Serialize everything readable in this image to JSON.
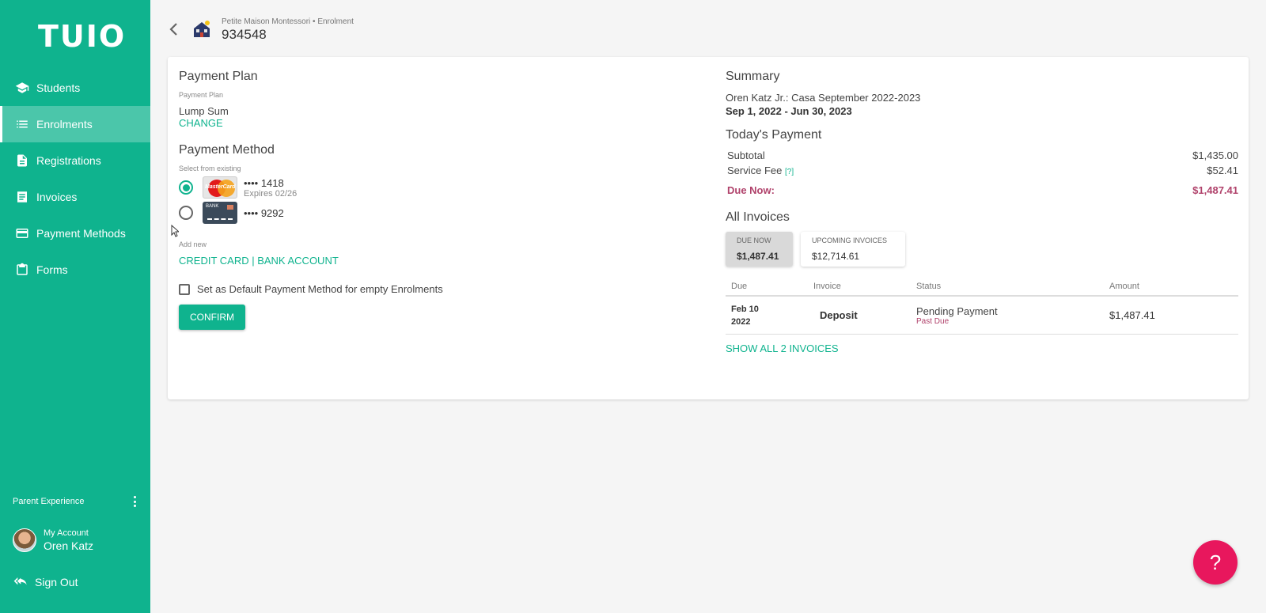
{
  "app": {
    "logo": "TUIO"
  },
  "sidebar": {
    "items": [
      {
        "label": "Students",
        "icon": "graduation-cap-icon"
      },
      {
        "label": "Enrolments",
        "icon": "list-icon",
        "active": true
      },
      {
        "label": "Registrations",
        "icon": "document-icon"
      },
      {
        "label": "Invoices",
        "icon": "invoice-list-icon"
      },
      {
        "label": "Payment Methods",
        "icon": "credit-card-icon"
      },
      {
        "label": "Forms",
        "icon": "clipboard-icon"
      }
    ],
    "parent_experience": "Parent Experience",
    "account_label": "My Account",
    "account_name": "Oren Katz",
    "sign_out": "Sign Out"
  },
  "header": {
    "breadcrumb": "Petite Maison Montessori • Enrolment",
    "enrolment_id": "934548"
  },
  "payment_plan": {
    "title": "Payment Plan",
    "sublabel": "Payment Plan",
    "value": "Lump Sum",
    "change": "CHANGE"
  },
  "payment_method": {
    "title": "Payment Method",
    "select_label": "Select from existing",
    "methods": [
      {
        "type": "MasterCard",
        "card_text": "MasterCard",
        "number": "•••• 1418",
        "expires": "Expires 02/26",
        "selected": true
      },
      {
        "type": "Bank",
        "card_text": "BANK",
        "number": "•••• 9292",
        "selected": false
      }
    ],
    "add_new_label": "Add new",
    "add_links": "CREDIT CARD | BANK ACCOUNT",
    "default_checkbox": "Set as Default Payment Method for empty Enrolments",
    "confirm": "CONFIRM"
  },
  "summary": {
    "title": "Summary",
    "program": "Oren Katz Jr.: Casa September 2022-2023",
    "dates": "Sep 1, 2022 - Jun 30, 2023",
    "todays_payment_title": "Today's Payment",
    "subtotal_label": "Subtotal",
    "subtotal": "$1,435.00",
    "fee_label": "Service Fee",
    "fee_help": "[?]",
    "fee": "$52.41",
    "due_label": "Due Now:",
    "due": "$1,487.41"
  },
  "invoices": {
    "title": "All Invoices",
    "tabs": [
      {
        "label": "DUE NOW",
        "value": "$1,487.41"
      },
      {
        "label": "UPCOMING INVOICES",
        "value": "$12,714.61"
      }
    ],
    "columns": [
      "Due",
      "Invoice",
      "Status",
      "Amount"
    ],
    "rows": [
      {
        "due_month_day": "Feb 10",
        "due_year": "2022",
        "invoice": "Deposit",
        "status": "Pending Payment",
        "substatus": "Past Due",
        "amount": "$1,487.41"
      }
    ],
    "show_all": "SHOW ALL 2 INVOICES"
  },
  "help": {
    "label": "?"
  },
  "colors": {
    "brand": "#0fb38e",
    "due": "#b0426b",
    "help": "#e8175d"
  }
}
